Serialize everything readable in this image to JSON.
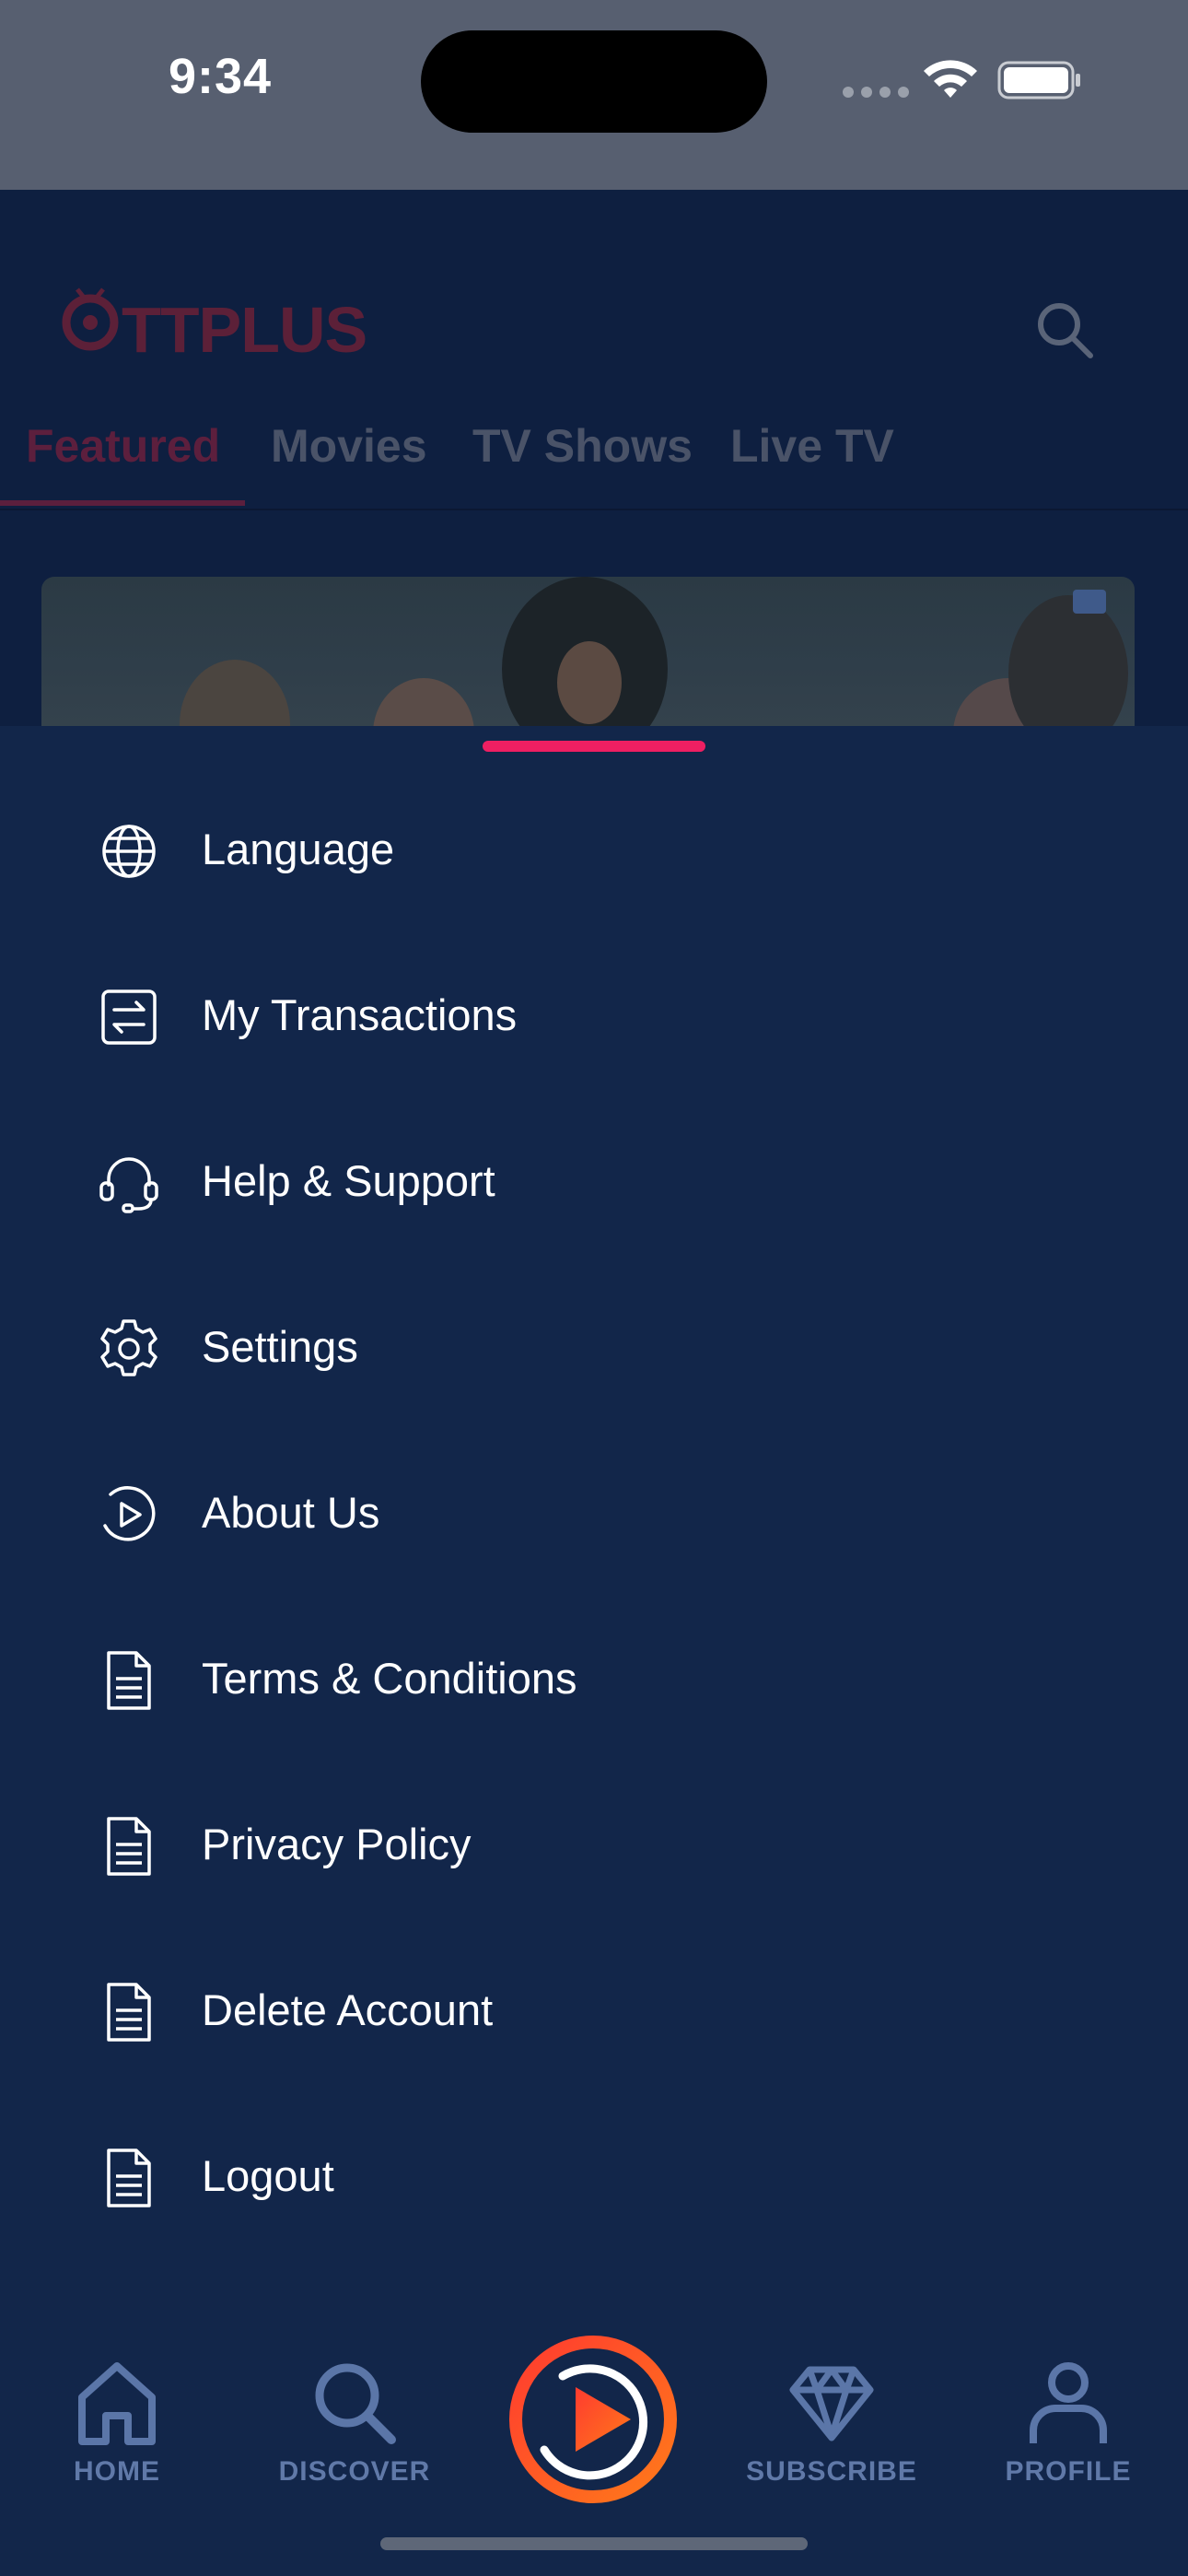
{
  "status_bar": {
    "time": "9:34"
  },
  "header": {
    "logo_text_main": "TTPLUS",
    "logo_initial": "O",
    "search_icon": "search-icon"
  },
  "tabs": [
    {
      "label": "Featured",
      "active": true
    },
    {
      "label": "Movies",
      "active": false
    },
    {
      "label": "TV Shows",
      "active": false
    },
    {
      "label": "Live TV",
      "active": false
    }
  ],
  "menu": {
    "items": [
      {
        "label": "Language",
        "icon": "globe-icon"
      },
      {
        "label": "My Transactions",
        "icon": "transactions-icon"
      },
      {
        "label": "Help & Support",
        "icon": "headset-icon"
      },
      {
        "label": "Settings",
        "icon": "gear-icon"
      },
      {
        "label": "About Us",
        "icon": "play-circle-icon"
      },
      {
        "label": "Terms & Conditions",
        "icon": "document-icon"
      },
      {
        "label": "Privacy Policy",
        "icon": "document-icon"
      },
      {
        "label": "Delete Account",
        "icon": "document-icon"
      },
      {
        "label": "Logout",
        "icon": "document-icon"
      }
    ]
  },
  "bottom_nav": {
    "items": [
      {
        "label": "HOME",
        "icon": "home-icon"
      },
      {
        "label": "DISCOVER",
        "icon": "search-icon"
      },
      {
        "label": "",
        "icon": "play-icon"
      },
      {
        "label": "SUBSCRIBE",
        "icon": "diamond-icon"
      },
      {
        "label": "PROFILE",
        "icon": "person-icon"
      }
    ]
  },
  "colors": {
    "sheet_bg": "#12264a",
    "accent": "#ee1f62",
    "play_orange": "#ff5a1f",
    "nav_inactive": "#6079a8"
  }
}
